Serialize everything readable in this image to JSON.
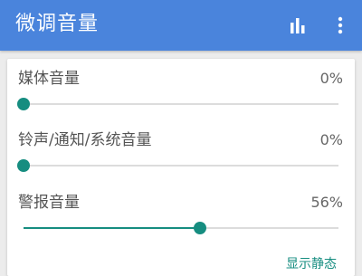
{
  "app_bar": {
    "title": "微调音量",
    "icons": [
      "bar-chart-icon",
      "more-vertical-icon"
    ]
  },
  "volumes": [
    {
      "label": "媒体音量",
      "percent": 0,
      "value_text": "0%"
    },
    {
      "label": "铃声/通知/系统音量",
      "percent": 0,
      "value_text": "0%"
    },
    {
      "label": "警报音量",
      "percent": 56,
      "value_text": "56%"
    }
  ],
  "footer": {
    "link_text": "显示静态"
  },
  "colors": {
    "app_bar": "#4a84dc",
    "accent": "#168d80",
    "track": "#dcdcdc"
  }
}
